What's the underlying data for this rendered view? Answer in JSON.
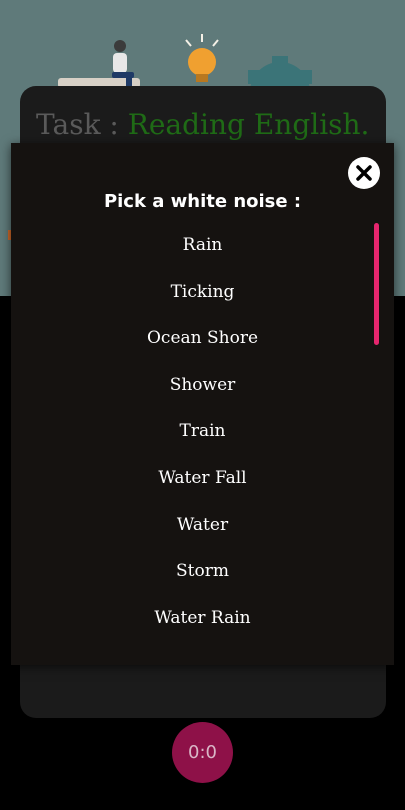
{
  "task": {
    "label": "Task : ",
    "name": "Reading English."
  },
  "modal": {
    "title": "Pick a white noise :",
    "close_icon": "close-icon",
    "items": [
      {
        "label": "Rain"
      },
      {
        "label": "Ticking"
      },
      {
        "label": "Ocean Shore"
      },
      {
        "label": "Shower"
      },
      {
        "label": "Train"
      },
      {
        "label": "Water Fall"
      },
      {
        "label": "Water"
      },
      {
        "label": "Storm"
      },
      {
        "label": "Water Rain"
      }
    ]
  },
  "timer": {
    "value": "0:0"
  },
  "colors": {
    "accent": "#e6266e",
    "timer_bg": "#8e1148",
    "task_name": "#1f6b16"
  }
}
